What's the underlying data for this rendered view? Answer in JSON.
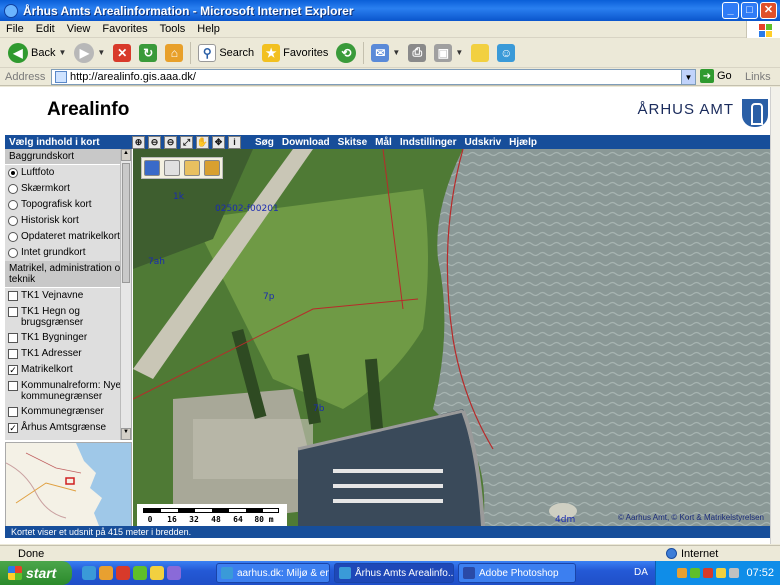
{
  "window": {
    "title": "Århus Amts Arealinformation - Microsoft Internet Explorer",
    "buttons": {
      "minimize": "_",
      "maximize": "□",
      "close": "✕"
    }
  },
  "menubar": [
    "File",
    "Edit",
    "View",
    "Favorites",
    "Tools",
    "Help"
  ],
  "toolbar": {
    "back": "Back",
    "search": "Search",
    "favorites": "Favorites"
  },
  "address": {
    "label": "Address",
    "url": "http://arealinfo.gis.aaa.dk/",
    "go": "Go",
    "links": "Links"
  },
  "page": {
    "title": "Arealinfo",
    "brand": "ÅRHUS AMT",
    "nav_left": "Vælg indhold i kort",
    "nav_menu": [
      "Søg",
      "Download",
      "Skitse",
      "Mål",
      "Indstillinger",
      "Udskriv",
      "Hjælp"
    ],
    "map_tools": [
      "⊕",
      "⊖",
      "⊖",
      "⤢",
      "✋",
      "✥",
      "i"
    ],
    "sidebar": {
      "section1": "Baggrundskort",
      "background_options": [
        {
          "label": "Luftfoto",
          "checked": true
        },
        {
          "label": "Skærmkort",
          "checked": false
        },
        {
          "label": "Topografisk kort",
          "checked": false
        },
        {
          "label": "Historisk kort",
          "checked": false
        },
        {
          "label": "Opdateret matrikelkort",
          "checked": false
        },
        {
          "label": "Intet grundkort",
          "checked": false
        }
      ],
      "section2": "Matrikel, administration og teknik",
      "layers": [
        {
          "label": "TK1 Vejnavne",
          "checked": false
        },
        {
          "label": "TK1 Hegn og brugsgrænser",
          "checked": false
        },
        {
          "label": "TK1 Bygninger",
          "checked": false
        },
        {
          "label": "TK1 Adresser",
          "checked": false
        },
        {
          "label": "Matrikelkort",
          "checked": true
        },
        {
          "label": "Kommunalreform: Nye kommunegrænser",
          "checked": false
        },
        {
          "label": "Kommunegrænser",
          "checked": false
        },
        {
          "label": "Århus Amtsgrænse",
          "checked": true
        }
      ]
    },
    "map": {
      "labels": [
        "1k",
        "02502-f00201",
        "7ah",
        "7p",
        "4dm",
        "7b"
      ],
      "scale_ticks": [
        "0",
        "16",
        "32",
        "48",
        "64",
        "80 m"
      ],
      "copyright": "© Aarhus Amt,  © Kort & Matrikelstyrelsen"
    },
    "status": "Kortet viser et udsnit på 415 meter i bredden."
  },
  "statusbar": {
    "text": "Done",
    "zone": "Internet"
  },
  "taskbar": {
    "start": "start",
    "tasks": [
      "aarhus.dk: Miljø & en...",
      "Århus Amts Arealinfo...",
      "Adobe Photoshop"
    ],
    "lang": "DA",
    "clock": "07:52"
  }
}
